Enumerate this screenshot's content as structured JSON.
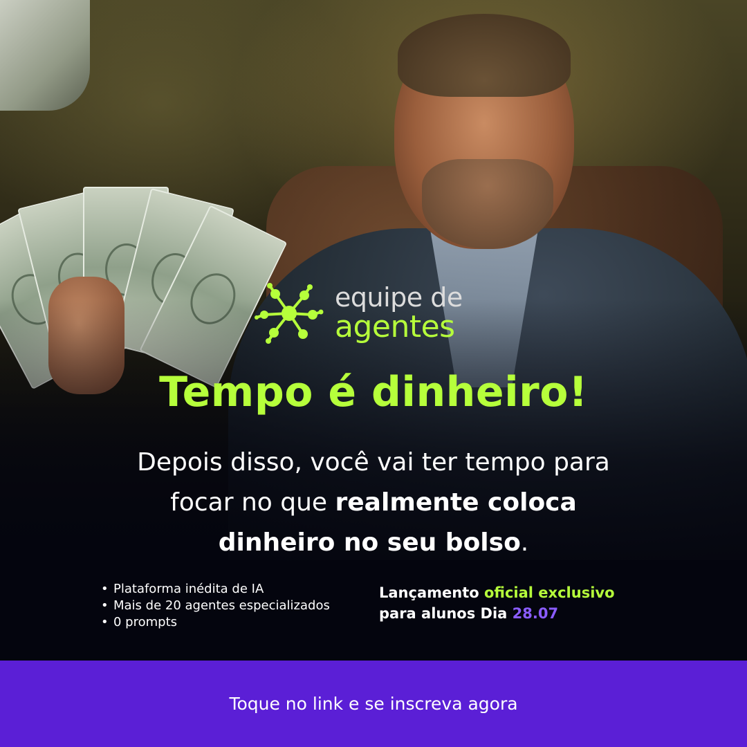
{
  "brand": {
    "line1": "equipe de",
    "line2": "agentes",
    "icon": "molecule-network-icon",
    "accent_color": "#b6ff3b"
  },
  "headline": "Tempo é dinheiro!",
  "body": {
    "line1": "Depois disso, você vai ter tempo para",
    "line2_regular": "focar no que ",
    "line2_bold": "realmente coloca",
    "line3_bold": "dinheiro no seu bolso",
    "line3_end": "."
  },
  "bullets": [
    "Plataforma inédita de IA",
    "Mais de 20 agentes especializados",
    "0 prompts"
  ],
  "launch": {
    "part1": "Lançamento ",
    "part2_highlight": "oficial exclusivo",
    "part3": "para alunos Dia ",
    "date": "28.07",
    "date_color": "#8a5cff"
  },
  "cta": {
    "label": "Toque no link e se inscreva agora",
    "bar_color": "#5b1fd6"
  }
}
